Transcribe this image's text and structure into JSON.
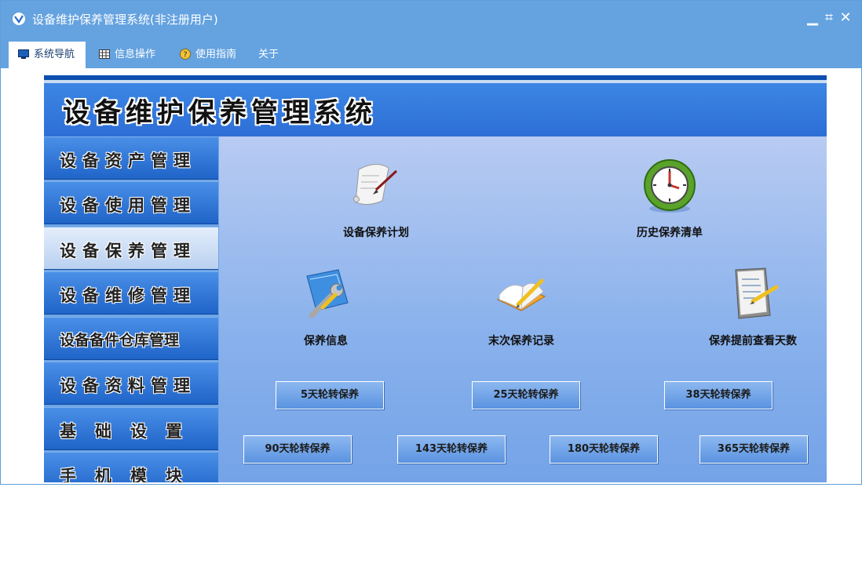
{
  "window": {
    "title": "设备维护保养管理系统(非注册用户)",
    "controls": {
      "minimize_glyph": "▁",
      "restore_glyph": "⌗",
      "close_glyph": "✕"
    }
  },
  "menu": [
    {
      "label": "系统导航",
      "icon": "monitor-icon",
      "active": true
    },
    {
      "label": "信息操作",
      "icon": "grid-icon",
      "active": false
    },
    {
      "label": "使用指南",
      "icon": "help-icon",
      "active": false
    },
    {
      "label": "关于",
      "icon": "",
      "active": false
    }
  ],
  "banner": {
    "title": "设备维护保养管理系统"
  },
  "sidebar": [
    {
      "label": "设备资产管理"
    },
    {
      "label": "设备使用管理"
    },
    {
      "label": "设备保养管理",
      "active": true
    },
    {
      "label": "设备维修管理"
    },
    {
      "label": "设备备件仓库管理"
    },
    {
      "label": "设备资料管理"
    },
    {
      "label": "基础设置"
    },
    {
      "label": "手机模块"
    }
  ],
  "features": [
    {
      "label": "设备保养计划",
      "icon": "scroll-pen-icon"
    },
    {
      "label": "历史保养清单",
      "icon": "clock-icon"
    },
    {
      "label": "保养信息",
      "icon": "wrench-folder-icon"
    },
    {
      "label": "末次保养记录",
      "icon": "notebook-pencil-icon"
    },
    {
      "label": "保养提前查看天数",
      "icon": "document-pencil-icon"
    }
  ],
  "rotation_buttons": [
    "5天轮转保养",
    "25天轮转保养",
    "38天轮转保养",
    "90天轮转保养",
    "143天轮转保养",
    "180天轮转保养",
    "365天轮转保养"
  ],
  "colors": {
    "titlebar": "#64a2e0",
    "banner": "#2d6ed6",
    "sidebar": "#1f64c8",
    "sidebar_active": "#b9d0f0",
    "content": "#8ab2ec"
  }
}
